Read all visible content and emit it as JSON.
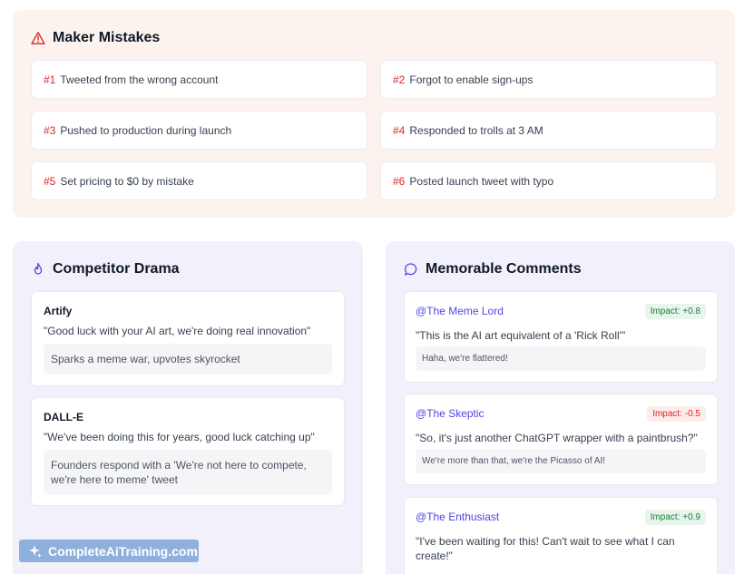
{
  "mistakes": {
    "title": "Maker Mistakes",
    "items": [
      {
        "num": "#1",
        "text": "Tweeted from the wrong account"
      },
      {
        "num": "#2",
        "text": "Forgot to enable sign-ups"
      },
      {
        "num": "#3",
        "text": "Pushed to production during launch"
      },
      {
        "num": "#4",
        "text": "Responded to trolls at 3 AM"
      },
      {
        "num": "#5",
        "text": "Set pricing to $0 by mistake"
      },
      {
        "num": "#6",
        "text": "Posted launch tweet with typo"
      }
    ]
  },
  "drama": {
    "title": "Competitor Drama",
    "items": [
      {
        "name": "Artify",
        "quote": "\"Good luck with your AI art, we're doing real innovation\"",
        "reaction": "Sparks a meme war, upvotes skyrocket"
      },
      {
        "name": "DALL-E",
        "quote": "\"We've been doing this for years, good luck catching up\"",
        "reaction": "Founders respond with a 'We're not here to compete, we're here to meme' tweet"
      }
    ]
  },
  "comments": {
    "title": "Memorable Comments",
    "items": [
      {
        "user": "@The Meme Lord",
        "impact": "Impact: +0.8",
        "text": "\"This is the AI art equivalent of a 'Rick Roll'\"",
        "reply": "Haha, we're flattered!"
      },
      {
        "user": "@The Skeptic",
        "impact": "Impact: -0.5",
        "text": "\"So, it's just another ChatGPT wrapper with a paintbrush?\"",
        "reply": "We're more than that, we're the Picasso of AI!"
      },
      {
        "user": "@The Enthusiast",
        "impact": "Impact: +0.9",
        "text": "\"I've been waiting for this! Can't wait to see what I can create!\"",
        "reply": ""
      }
    ]
  },
  "watermark": {
    "text": "CompleteAiTraining.com"
  },
  "colors": {
    "accent_red": "#dc2626",
    "accent_indigo": "#4f46e5",
    "positive": "#15803d",
    "negative": "#dc2626"
  }
}
